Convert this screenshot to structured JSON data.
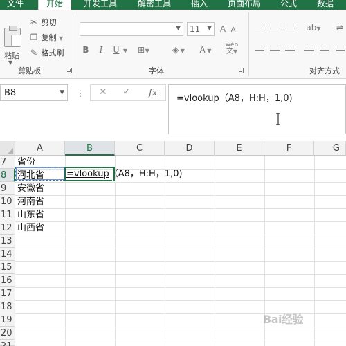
{
  "ribbon_tabs": [
    {
      "label": "文件",
      "active": false
    },
    {
      "label": "开始",
      "active": true
    },
    {
      "label": "开发工具",
      "active": false
    },
    {
      "label": "解密工具",
      "active": false
    },
    {
      "label": "插入",
      "active": false
    },
    {
      "label": "页面布局",
      "active": false
    },
    {
      "label": "公式",
      "active": false
    },
    {
      "label": "数据",
      "active": false
    }
  ],
  "clipboard": {
    "paste_label": "粘贴",
    "cut_label": "剪切",
    "copy_label": "复制",
    "format_painter_label": "格式刷",
    "group_label": "剪贴板"
  },
  "font": {
    "font_name": "",
    "font_size": "11",
    "bold": "B",
    "italic": "I",
    "underline": "U",
    "grow": "A",
    "shrink": "A",
    "font_color_glyph": "A",
    "wen_glyph": "wén",
    "group_label": "字体"
  },
  "alignment": {
    "group_label": "对齐方式"
  },
  "formula_bar": {
    "name_box": "B8",
    "cancel_glyph": "✕",
    "enter_glyph": "✓",
    "fx_label": "fx",
    "formula": "=vlookup（A8，H:H，1,0)"
  },
  "columns": [
    "A",
    "B",
    "C",
    "D",
    "E",
    "F",
    "G"
  ],
  "selected_column": "B",
  "rows": [
    "7",
    "8",
    "9",
    "10",
    "11",
    "12",
    "13",
    "14",
    "15",
    "16",
    "17",
    "18",
    "19",
    "20",
    "21"
  ],
  "selected_row": "8",
  "cells": {
    "A7": "省份",
    "A8": "河北省",
    "A9": "安徽省",
    "A10": "河南省",
    "A11": "山东省",
    "A12": "山西省",
    "B8_part1": "=vlookup",
    "B8_part2": "（A8，H:H，1,0)"
  },
  "watermark": "Bai经验"
}
